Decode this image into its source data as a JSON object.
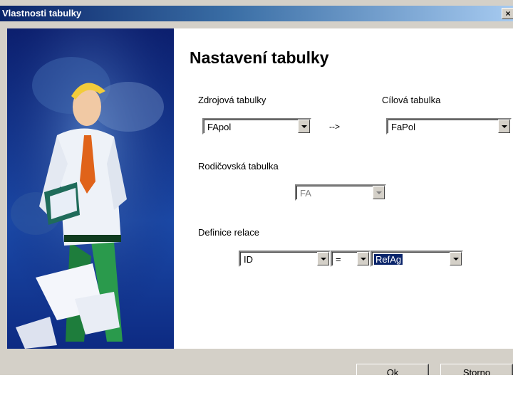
{
  "window": {
    "title": "Vlastnosti tabulky",
    "close_glyph": "×"
  },
  "page": {
    "heading": "Nastavení tabulky"
  },
  "source": {
    "label": "Zdrojová tabulky",
    "value": "FApol"
  },
  "target": {
    "label": "Cílová tabulka",
    "value": "FaPol"
  },
  "arrow_text": "-->",
  "parent": {
    "label": "Rodičovská tabulka",
    "value": "FA"
  },
  "relation": {
    "label": "Definice relace",
    "left_field": "ID",
    "operator": "=",
    "right_field": "RefAg"
  },
  "buttons": {
    "ok": "Ok",
    "cancel": "Storno"
  },
  "colors": {
    "title_bar": "#0a246a",
    "art_background": "#12338a",
    "selection": "#0a246a"
  }
}
